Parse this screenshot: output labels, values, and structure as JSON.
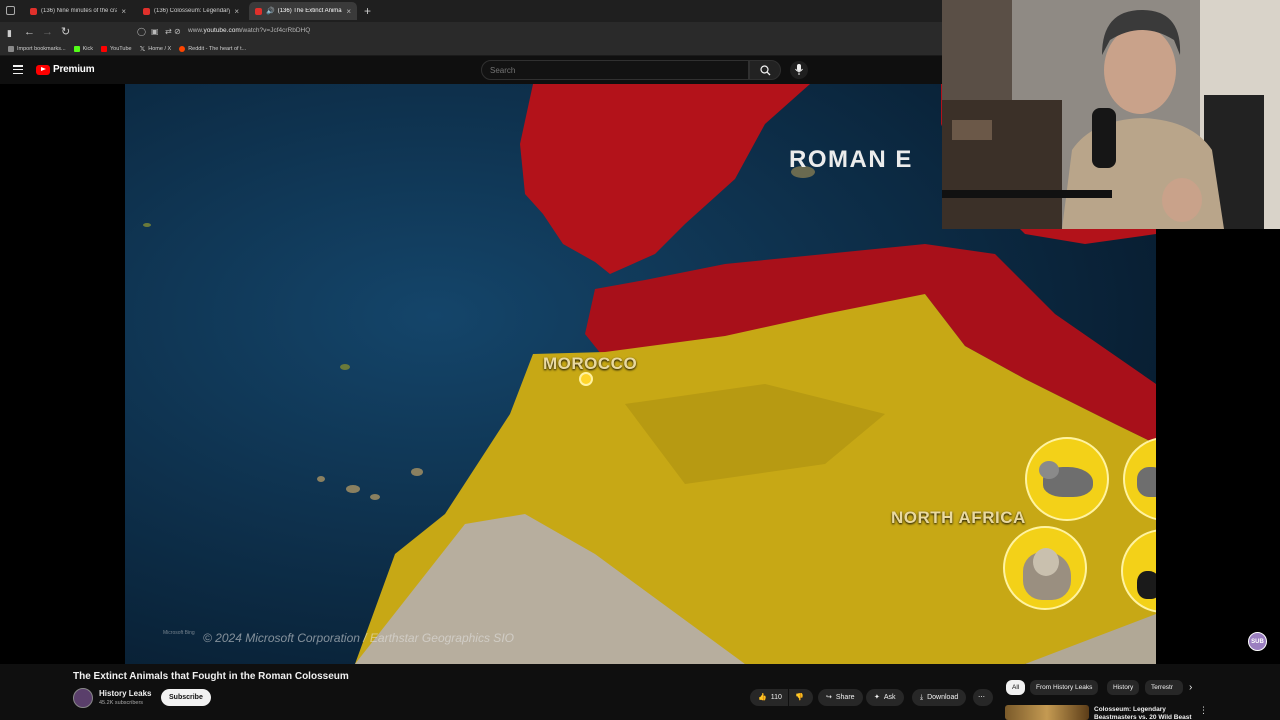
{
  "browser": {
    "tabs": [
      {
        "label": "(136) Nine minutes of the crazi"
      },
      {
        "label": "(136) Colosseum: Legendary Be"
      },
      {
        "label": "(136) The Extinct Animals t"
      }
    ],
    "url_prefix": "www.",
    "url_domain": "youtube.com",
    "url_path": "/watch?v=Jcf4crRbDHQ",
    "bookmarks": [
      {
        "label": "Import bookmarks...",
        "color": "#8a8a8a"
      },
      {
        "label": "Kick",
        "color": "#53fc18"
      },
      {
        "label": "YouTube",
        "color": "#ff0000"
      },
      {
        "label": "Home / X",
        "color": "#ffffff"
      },
      {
        "label": "Reddit - The heart of t...",
        "color": "#ff4500"
      }
    ]
  },
  "youtube": {
    "logo_text": "Premium",
    "search_placeholder": "Search"
  },
  "video_frame": {
    "label_roman": "ROMAN E",
    "label_morocco": "MOROCCO",
    "label_north_africa": "NORTH AFRICA",
    "copyright": "© 2024 Microsoft Corporation / Earthstar Geographics  SIO",
    "ms_logo": "Microsoft Bing"
  },
  "sub_badge": "SUB",
  "video": {
    "title": "The Extinct Animals that Fought in the Roman Colosseum",
    "channel": "History Leaks",
    "subscribers": "45.2K subscribers",
    "subscribe_label": "Subscribe",
    "likes": "110",
    "share_label": "Share",
    "ask_label": "Ask",
    "download_label": "Download"
  },
  "chips": [
    "All",
    "From History Leaks",
    "History",
    "Terrestr"
  ],
  "recommendation": {
    "title": "Colosseum: Legendary Beastmasters vs. 20 Wild Beast"
  }
}
